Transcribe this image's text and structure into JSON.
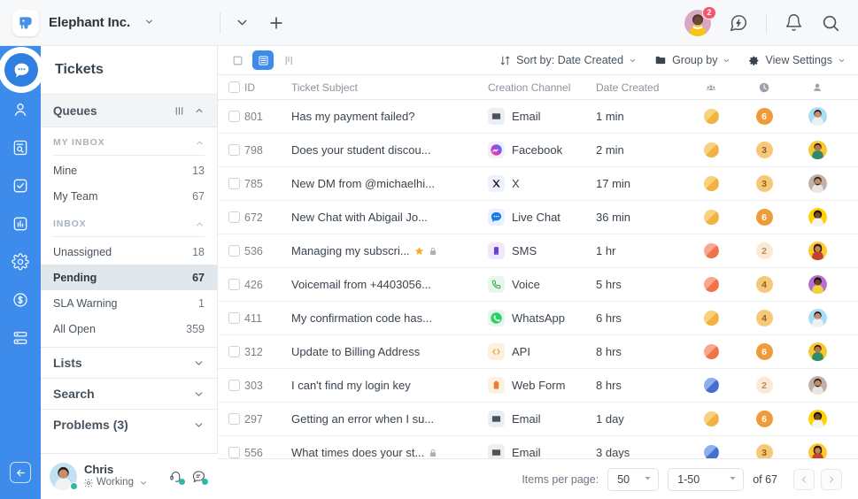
{
  "topbar": {
    "brand_name": "Elephant Inc.",
    "brand_icon": "elephant-logo",
    "chevron_icon": "chevron-down-icon",
    "add_icon": "plus-icon",
    "dropdown_icon": "chevron-down-icon",
    "avatar_badge": "2",
    "quick_icon": "lightning-chat-icon",
    "bell_icon": "bell-icon",
    "search_icon": "search-icon"
  },
  "rail": {
    "items": [
      {
        "name": "chat-icon",
        "active": true
      },
      {
        "name": "contacts-icon",
        "active": false
      },
      {
        "name": "knowledge-base-icon",
        "active": false
      },
      {
        "name": "tasks-icon",
        "active": false
      },
      {
        "name": "reports-icon",
        "active": false
      },
      {
        "name": "settings-icon",
        "active": false
      },
      {
        "name": "billing-icon",
        "active": false
      },
      {
        "name": "integrations-icon",
        "active": false
      }
    ],
    "collapse_icon": "arrow-left-icon"
  },
  "sidebar": {
    "title": "Tickets",
    "queues_label": "Queues",
    "queues_columns_icon": "columns-icon",
    "queues_collapse_icon": "chevron-up-icon",
    "groups": [
      {
        "label": "MY INBOX",
        "collapse_icon": "chevron-up-icon",
        "items": [
          {
            "label": "Mine",
            "count": "13",
            "selected": false
          },
          {
            "label": "My Team",
            "count": "67",
            "selected": false
          }
        ]
      },
      {
        "label": "INBOX",
        "collapse_icon": "chevron-up-icon",
        "items": [
          {
            "label": "Unassigned",
            "count": "18",
            "selected": false
          },
          {
            "label": "Pending",
            "count": "67",
            "selected": true
          },
          {
            "label": "SLA Warning",
            "count": "1",
            "selected": false
          },
          {
            "label": "All Open",
            "count": "359",
            "selected": false
          }
        ]
      }
    ],
    "sections": [
      {
        "label": "Lists",
        "icon": "chevron-down-icon"
      },
      {
        "label": "Search",
        "icon": "chevron-down-icon"
      },
      {
        "label": "Problems (3)",
        "icon": "chevron-down-icon"
      }
    ],
    "user": {
      "name": "Chris",
      "status": "Working",
      "status_icon": "sun-icon",
      "status_chevron": "chevron-down-icon",
      "icon_1": "headset-icon",
      "icon_2": "chat-status-icon"
    }
  },
  "toolbar": {
    "view_card_icon": "card-view-icon",
    "view_list_icon": "list-view-icon",
    "view_board_icon": "board-view-icon",
    "sort_label": "Sort by: Date Created",
    "sort_icon": "sort-icon",
    "group_label": "Group by",
    "group_icon": "folder-icon",
    "settings_label": "View Settings",
    "settings_icon": "gear-icon",
    "caret_icon": "chevron-down-icon"
  },
  "table": {
    "columns": [
      "ID",
      "Ticket Subject",
      "Creation Channel",
      "Date Created"
    ],
    "icon_columns": [
      "group-icon",
      "clock-icon",
      "person-icon"
    ],
    "rows": [
      {
        "id": "801",
        "subject": "Has my payment failed?",
        "channel": "Email",
        "channel_icon": "email-icon",
        "date": "1 min",
        "priority": "yellow",
        "count": "6",
        "count_level": "high",
        "avatar": "av1",
        "starred": false,
        "locked": false
      },
      {
        "id": "798",
        "subject": "Does your student discou...",
        "channel": "Facebook",
        "channel_icon": "facebook-messenger-icon",
        "date": "2 min",
        "priority": "yellow",
        "count": "3",
        "count_level": "mid",
        "avatar": "av2",
        "starred": false,
        "locked": false
      },
      {
        "id": "785",
        "subject": "New DM from @michaelhi...",
        "channel": "X",
        "channel_icon": "x-twitter-icon",
        "date": "17 min",
        "priority": "yellow",
        "count": "3",
        "count_level": "mid",
        "avatar": "av3",
        "starred": false,
        "locked": false
      },
      {
        "id": "672",
        "subject": "New Chat with Abigail Jo...",
        "channel": "Live Chat",
        "channel_icon": "live-chat-icon",
        "date": "36 min",
        "priority": "yellow",
        "count": "6",
        "count_level": "high",
        "avatar": "av4",
        "starred": false,
        "locked": false
      },
      {
        "id": "536",
        "subject": "Managing my subscri...",
        "channel": "SMS",
        "channel_icon": "sms-icon",
        "date": "1 hr",
        "priority": "red",
        "count": "2",
        "count_level": "low",
        "avatar": "av5",
        "starred": true,
        "locked": true
      },
      {
        "id": "426",
        "subject": "Voicemail from +4403056...",
        "channel": "Voice",
        "channel_icon": "phone-icon",
        "date": "5 hrs",
        "priority": "red",
        "count": "4",
        "count_level": "mid",
        "avatar": "av6",
        "starred": false,
        "locked": false
      },
      {
        "id": "411",
        "subject": "My confirmation code has...",
        "channel": "WhatsApp",
        "channel_icon": "whatsapp-icon",
        "date": "6 hrs",
        "priority": "yellow",
        "count": "4",
        "count_level": "mid",
        "avatar": "av1",
        "starred": false,
        "locked": false
      },
      {
        "id": "312",
        "subject": "Update to Billing Address",
        "channel": "API",
        "channel_icon": "code-icon",
        "date": "8 hrs",
        "priority": "red",
        "count": "6",
        "count_level": "high",
        "avatar": "av2",
        "starred": false,
        "locked": false
      },
      {
        "id": "303",
        "subject": "I can't find my login key",
        "channel": "Web Form",
        "channel_icon": "clipboard-icon",
        "date": "8 hrs",
        "priority": "blue",
        "count": "2",
        "count_level": "low",
        "avatar": "av3",
        "starred": false,
        "locked": false
      },
      {
        "id": "297",
        "subject": "Getting an error when I su...",
        "channel": "Email",
        "channel_icon": "email-icon",
        "date": "1 day",
        "priority": "yellow",
        "count": "6",
        "count_level": "high",
        "avatar": "av4",
        "starred": false,
        "locked": false
      },
      {
        "id": "556",
        "subject": "What times does your st...",
        "channel": "Email",
        "channel_icon": "email-icon",
        "date": "3 days",
        "priority": "blue",
        "count": "3",
        "count_level": "mid",
        "avatar": "av5",
        "starred": false,
        "locked": true
      }
    ]
  },
  "pagination": {
    "items_label": "Items per page:",
    "page_size": "50",
    "range": "1-50",
    "total": "of 67",
    "prev_icon": "chevron-left-icon",
    "next_icon": "chevron-right-icon"
  },
  "colors": {
    "brand_blue": "#3d8bea",
    "selected_bg": "#e2e7ec",
    "badge_red": "#f4566b"
  }
}
